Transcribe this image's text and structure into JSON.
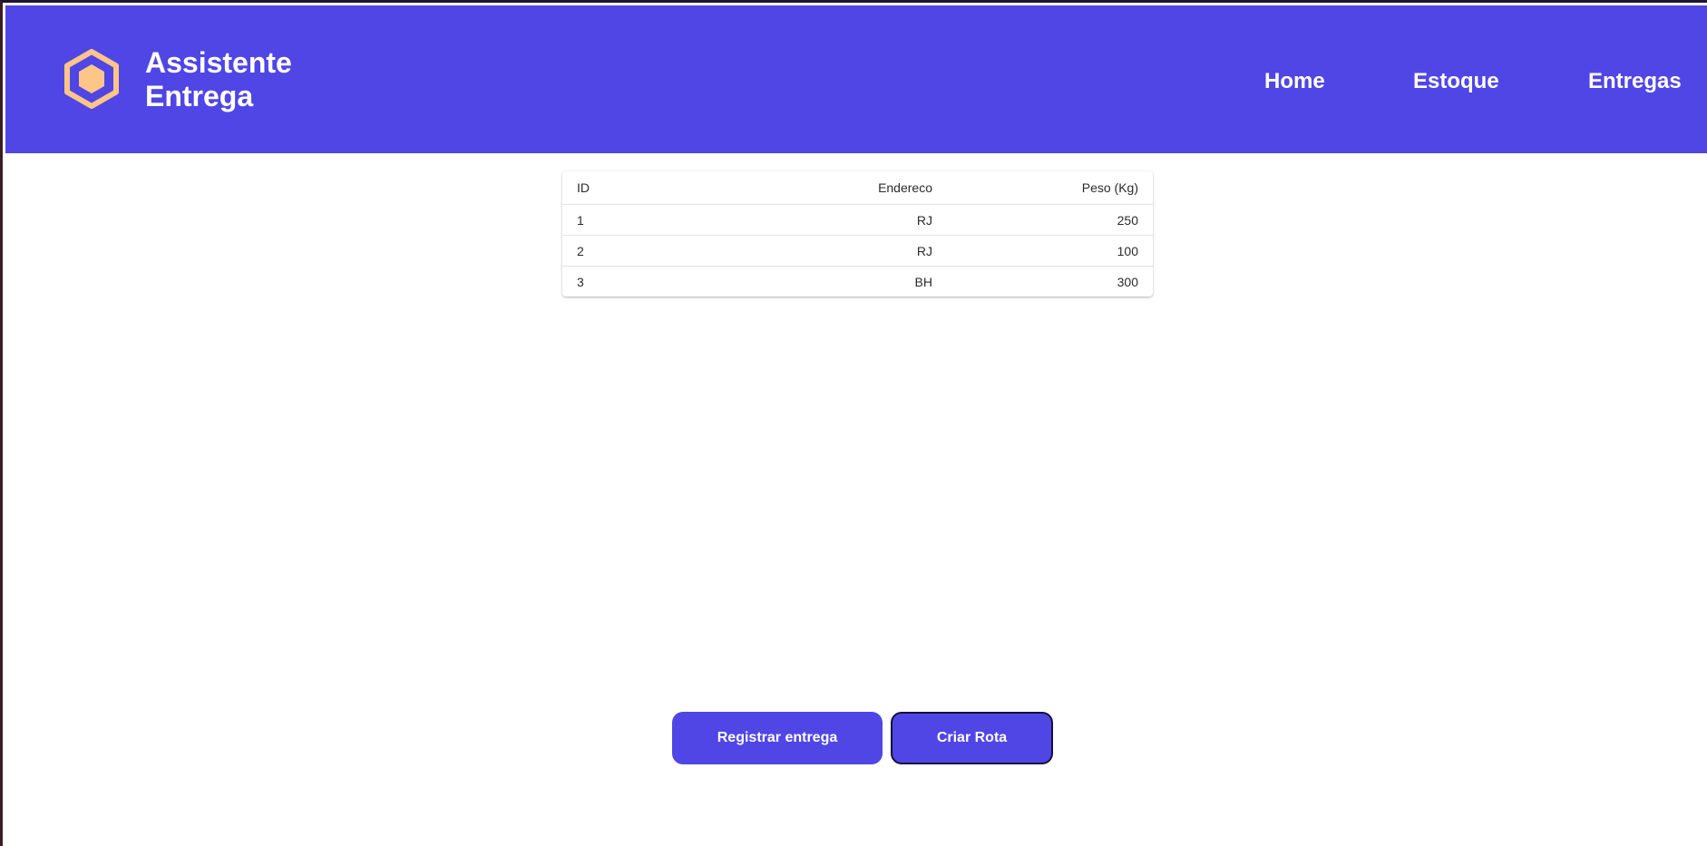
{
  "header": {
    "brand_line1": "Assistente",
    "brand_line2": "Entrega",
    "logo_icon": "hexagon-icon",
    "bg_color": "#4f46e5",
    "logo_color": "#fdc587",
    "nav": [
      {
        "label": "Home"
      },
      {
        "label": "Estoque"
      },
      {
        "label": "Entregas"
      }
    ]
  },
  "table": {
    "columns": {
      "id": "ID",
      "endereco": "Endereco",
      "peso": "Peso (Kg)"
    },
    "rows": [
      {
        "id": "1",
        "endereco": "RJ",
        "peso": "250"
      },
      {
        "id": "2",
        "endereco": "RJ",
        "peso": "100"
      },
      {
        "id": "3",
        "endereco": "BH",
        "peso": "300"
      }
    ]
  },
  "actions": {
    "registrar_label": "Registrar entrega",
    "criar_rota_label": "Criar Rota"
  }
}
